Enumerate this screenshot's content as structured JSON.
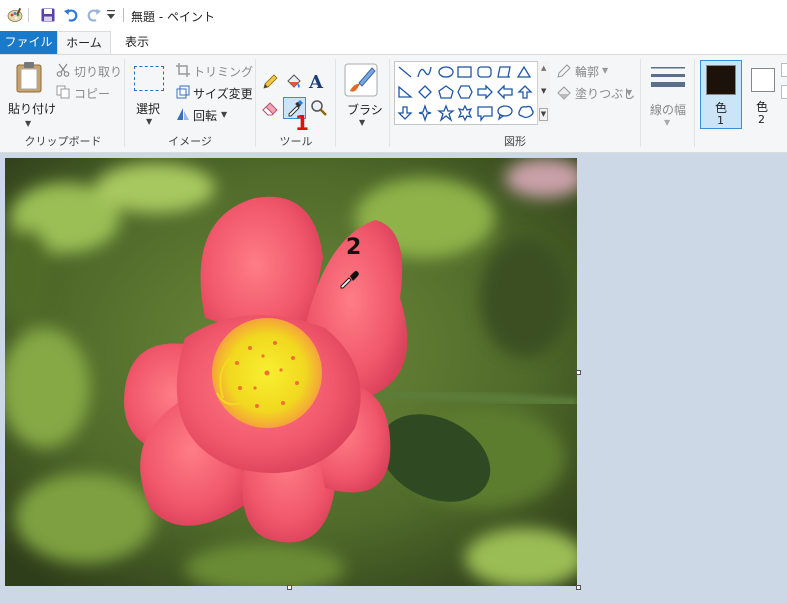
{
  "app": {
    "title": "無題 - ペイント"
  },
  "tabs": {
    "file": "ファイル",
    "home": "ホーム",
    "view": "表示"
  },
  "clipboard": {
    "paste": "貼り付け",
    "cut": "切り取り",
    "copy": "コピー",
    "group": "クリップボード"
  },
  "image": {
    "select": "選択",
    "crop": "トリミング",
    "resize": "サイズ変更",
    "rotate": "回転",
    "group": "イメージ"
  },
  "tools": {
    "group": "ツール",
    "text_glyph": "A"
  },
  "brushes": {
    "label": "ブラシ"
  },
  "shapes": {
    "outline": "輪郭",
    "fill": "塗りつぶし",
    "group": "図形"
  },
  "size": {
    "label": "線の幅"
  },
  "colors": {
    "color1_label": "色",
    "color1_num": "1",
    "color2_label": "色",
    "color2_num": "2",
    "color1_value": "#1c120a",
    "color2_value": "#ffffff"
  },
  "annotations": {
    "step1": "1",
    "step2": "2"
  }
}
